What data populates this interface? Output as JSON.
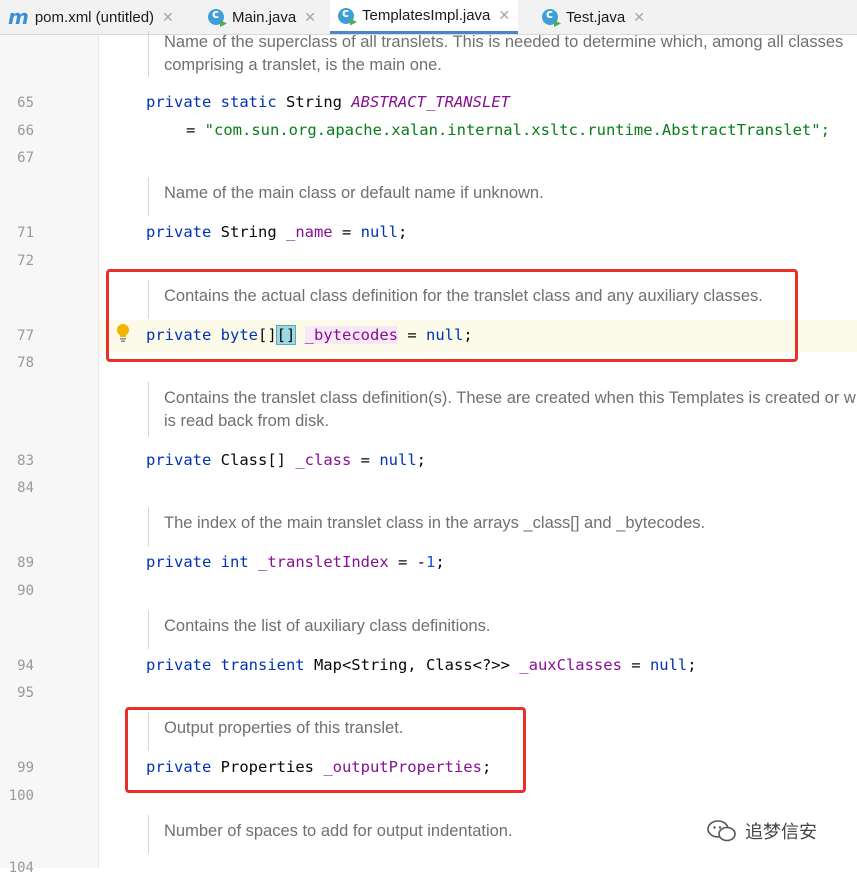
{
  "tabs": [
    {
      "label": "pom.xml (untitled)",
      "icon": "maven-icon"
    },
    {
      "label": "Main.java",
      "icon": "java-class-icon"
    },
    {
      "label": "TemplatesImpl.java",
      "icon": "java-class-icon",
      "active": true
    },
    {
      "label": "Test.java",
      "icon": "java-class-icon"
    }
  ],
  "line_numbers": [
    "65",
    "66",
    "67",
    "71",
    "72",
    "77",
    "78",
    "83",
    "84",
    "89",
    "90",
    "94",
    "95",
    "99",
    "100",
    "104"
  ],
  "docs": {
    "d1a": "Name of the superclass of all translets. This is needed to determine which, among all classes",
    "d1b": "comprising a translet, is the main one.",
    "d2": "Name of the main class or default name if unknown.",
    "d3": "Contains the actual class definition for the translet class and any auxiliary classes.",
    "d4a": "Contains the translet class definition(s). These are created when this Templates is created or when it",
    "d4b": "is read back from disk.",
    "d5": "The index of the main translet class in the arrays _class[] and _bytecodes.",
    "d6": "Contains the list of auxiliary class definitions.",
    "d7": "Output properties of this translet.",
    "d8": "Number of spaces to add for output indentation."
  },
  "code": {
    "l65_kw": "private static",
    "l65_type": " String ",
    "l65_field": "ABSTRACT_TRANSLET",
    "l66_eq": "= ",
    "l66_str": "\"com.sun.org.apache.xalan.internal.xsltc.runtime.AbstractTranslet\";",
    "l71_kw": "private",
    "l71_type": " String ",
    "l71_field": "_name",
    "l71_eq": " = ",
    "l71_null": "null",
    "l71_end": ";",
    "l77_kw": "private byte",
    "l77_br1": "[]",
    "l77_br2": "[]",
    "l77_sp": " ",
    "l77_field": "_bytecodes",
    "l77_eq": " = ",
    "l77_null": "null",
    "l77_end": ";",
    "l83_kw": "private",
    "l83_type": " Class[] ",
    "l83_field": "_class",
    "l83_eq": " = ",
    "l83_null": "null",
    "l83_end": ";",
    "l89_kw": "private int",
    "l89_sp": " ",
    "l89_field": "_transletIndex",
    "l89_eq": " = -",
    "l89_num": "1",
    "l89_end": ";",
    "l94_kw": "private transient",
    "l94_type": " Map<String, Class<?>> ",
    "l94_field": "_auxClasses",
    "l94_eq": " = ",
    "l94_null": "null",
    "l94_end": ";",
    "l99_kw": "private",
    "l99_type": " Properties ",
    "l99_field": "_outputProperties",
    "l99_end": ";"
  },
  "watermark": "追梦信安",
  "colors": {
    "keyword": "#0033b3",
    "field": "#871094",
    "string": "#067d17",
    "annotation_box": "#e8302a"
  }
}
